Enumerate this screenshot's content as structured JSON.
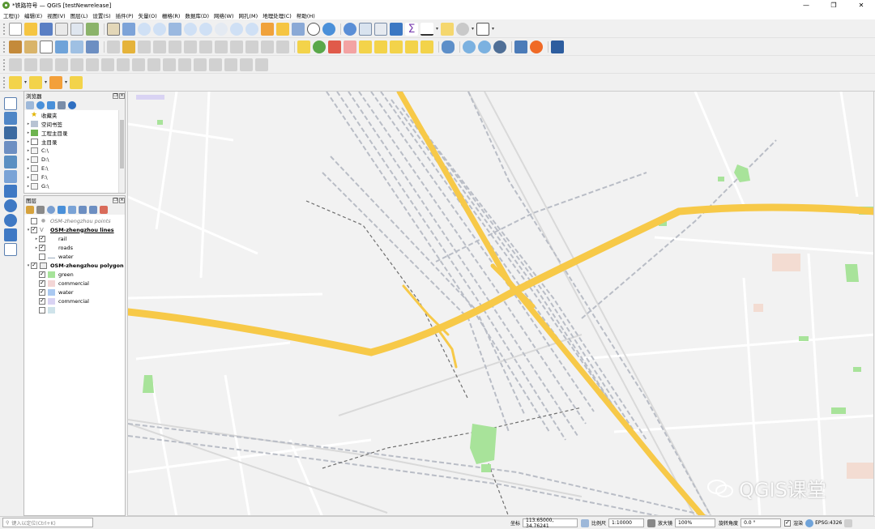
{
  "window": {
    "title": "*铁路符号 — QGIS [testNewrelease]",
    "controls": [
      "—",
      "❐",
      "✕"
    ]
  },
  "menu": [
    "工程(J)",
    "编辑(E)",
    "视图(V)",
    "图层(L)",
    "设置(S)",
    "插件(P)",
    "矢量(O)",
    "栅格(R)",
    "数据库(D)",
    "网络(W)",
    "网孔(M)",
    "地理处理(C)",
    "帮助(H)"
  ],
  "browser": {
    "title": "浏览器",
    "items": [
      {
        "label": "收藏夹",
        "icon": "star-icon"
      },
      {
        "label": "空间书签",
        "icon": "bookmark-icon"
      },
      {
        "label": "工程主目录",
        "icon": "project-home-icon"
      },
      {
        "label": "主目录",
        "icon": "home-icon"
      },
      {
        "label": "C:\\",
        "icon": "folder-icon"
      },
      {
        "label": "D:\\",
        "icon": "folder-icon"
      },
      {
        "label": "E:\\",
        "icon": "folder-icon"
      },
      {
        "label": "F:\\",
        "icon": "folder-icon"
      },
      {
        "label": "G:\\",
        "icon": "folder-icon"
      }
    ]
  },
  "layers": {
    "title": "图层",
    "items": [
      {
        "label": "OSM-zhengzhou points",
        "checked": false,
        "style": "italic-grey"
      },
      {
        "label": "OSM-zhengzhou lines",
        "checked": true,
        "style": "bold-underline"
      },
      {
        "label": "rail",
        "checked": true,
        "style": "child-expand"
      },
      {
        "label": "roads",
        "checked": true,
        "style": "child-expand"
      },
      {
        "label": "water",
        "checked": false,
        "style": "child-line"
      },
      {
        "label": "OSM-zhengzhou polygon",
        "checked": true,
        "style": "bold"
      },
      {
        "label": "green",
        "checked": true,
        "color": "#a6e39a"
      },
      {
        "label": "commercial",
        "checked": true,
        "color": "#f3d6d6"
      },
      {
        "label": "water",
        "checked": true,
        "color": "#aac9f1"
      },
      {
        "label": "commercial",
        "checked": true,
        "color": "#d9d3f3"
      },
      {
        "label": "",
        "checked": false,
        "color": "#cfe3ea"
      }
    ]
  },
  "locator": {
    "placeholder": "键入以定位(Ctrl+K)"
  },
  "status": {
    "coord_label": "坐标",
    "coord_value": "113.65000, 34.76241",
    "scale_label": "比例尺",
    "scale_value": "1:10000",
    "magnifier_label": "放大镜",
    "magnifier_value": "100%",
    "rotation_label": "旋转角度",
    "rotation_value": "0.0 °",
    "render_label": "渲染",
    "crs": "EPSG:4326"
  },
  "watermark": "QGIS课堂",
  "colors": {
    "road": "#f7c948",
    "rail": "#b9bdc6",
    "green": "#a8e39a",
    "map_bg": "#f2f2f2"
  }
}
